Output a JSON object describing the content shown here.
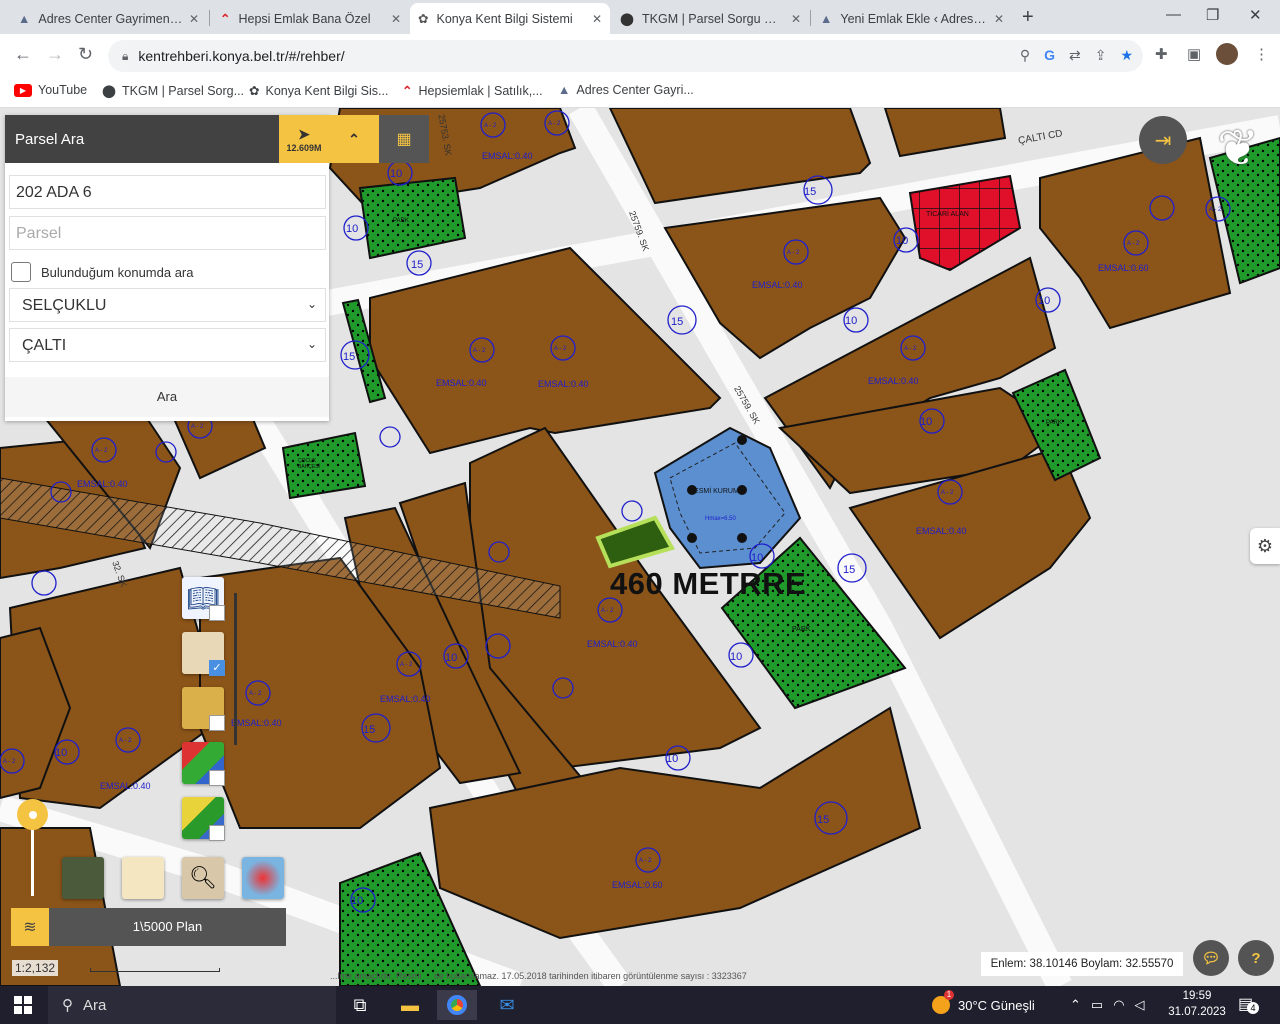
{
  "browser": {
    "tabs": [
      {
        "title": "Adres Center Gayrimenkul",
        "icon": "adres-icon",
        "active": false
      },
      {
        "title": "Hepsi Emlak Bana Özel",
        "icon": "hepsiemlak-icon",
        "active": false
      },
      {
        "title": "Konya Kent Bilgi Sistemi",
        "icon": "konya-icon",
        "active": true
      },
      {
        "title": "TKGM | Parsel Sorgu Uygu",
        "icon": "location-pin-icon",
        "active": false
      },
      {
        "title": "Yeni Emlak Ekle ‹ Adres Ce",
        "icon": "adres-icon",
        "active": false
      }
    ],
    "url": "kentrehberi.konya.bel.tr/#/rehber/",
    "bookmarks": [
      {
        "label": "YouTube",
        "icon": "youtube-icon"
      },
      {
        "label": "TKGM | Parsel Sorg...",
        "icon": "location-pin-icon"
      },
      {
        "label": "Konya Kent Bilgi Sis...",
        "icon": "konya-icon"
      },
      {
        "label": "Hepsiemlak | Satılık,...",
        "icon": "hepsiemlak-icon"
      },
      {
        "label": "Adres Center Gayri...",
        "icon": "adres-icon"
      }
    ]
  },
  "panel": {
    "title": "Parsel Ara",
    "distance": "12.609M",
    "ada_value": "202 ADA 6",
    "parsel_placeholder": "Parsel",
    "checkbox_label": "Bulunduğum konumda ara",
    "district": "SELÇUKLU",
    "neighborhood": "ÇALTI",
    "search_button": "Ara"
  },
  "map": {
    "overlay_text": "460 METRRE",
    "street_labels": [
      "ÇALTI CD",
      "25759. SK",
      "25759. SK",
      "25753. SK",
      "32. SK"
    ],
    "labels": {
      "emsal_040": "EMSAL:0.40",
      "emsal_060": "EMSAL:0.60",
      "resmi_kurum": "RESMİ KURUM",
      "ticari": "TİCARİ ALAN",
      "park": "PARK",
      "cocuk_bahcesi": "ÇOCUK BAHÇESİ",
      "hmax": "Hmax=6.50"
    },
    "circle_labels": [
      "10",
      "15",
      "A - 2"
    ],
    "coords_text": "Enlem: 38.10146 Boylam: 32.55570",
    "scale_text": "1:2,132",
    "layer_bar_text": "1\\5000 Plan",
    "footer_note": "...lme amaçlıdır. Resmi ... de kullanılamaz. 17.05.2018 tarihinden itibaren görüntülenme sayısı : 3323367",
    "chat_icon": "chat-icon",
    "help_label": "?",
    "settings_icon": "gear-icon",
    "login_icon": "login-icon"
  },
  "taskbar": {
    "search_placeholder": "Ara",
    "weather": "30°C  Güneşli",
    "weather_badge": "1",
    "time": "19:59",
    "date": "31.07.2023",
    "notification_count": "4"
  },
  "colors": {
    "parcel_brown": "#8b5419",
    "park_green": "#1f9a2b",
    "institution_blue": "#5b8fd0",
    "commercial_red": "#e0102a",
    "accent_yellow": "#f5c342",
    "panel_dark": "#424242"
  }
}
